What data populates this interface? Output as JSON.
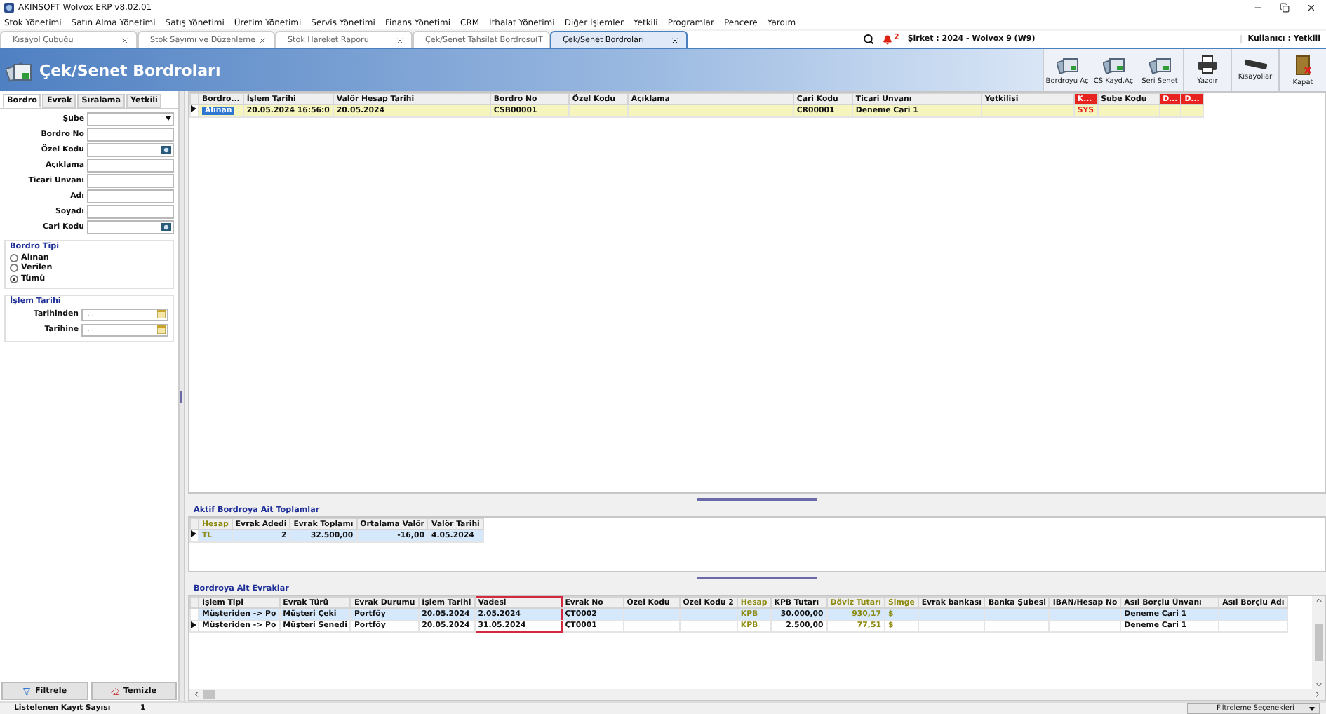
{
  "window": {
    "title": "AKINSOFT Wolvox ERP v8.02.01"
  },
  "menu": [
    "Stok Yönetimi",
    "Satın Alma Yönetimi",
    "Satış Yönetimi",
    "Üretim Yönetimi",
    "Servis Yönetimi",
    "Finans Yönetimi",
    "CRM",
    "İthalat Yönetimi",
    "Diğer İşlemler",
    "Yetkili",
    "Programlar",
    "Pencere",
    "Yardım"
  ],
  "doc_tabs": [
    {
      "label": "Kısayol Çubuğu",
      "selected": false
    },
    {
      "label": "Stok Sayımı ve Düzenleme",
      "selected": false
    },
    {
      "label": "Stok Hareket Raporu",
      "selected": false
    },
    {
      "label": "Çek/Senet Tahsilat Bordrosu(T",
      "selected": false
    },
    {
      "label": "Çek/Senet Bordroları",
      "selected": true
    }
  ],
  "notifications": {
    "count": "2"
  },
  "company": "Şirket : 2024 - Wolvox 9  (W9)",
  "user": "Kullanıcı : Yetkili",
  "page_title": "Çek/Senet Bordroları",
  "toolbar": [
    {
      "label": "Bordroyu Aç",
      "kind": "docs"
    },
    {
      "label": "CS Kayd.Aç",
      "kind": "docs"
    },
    {
      "label": "Seri Senet",
      "kind": "docs"
    },
    {
      "label": "Yazdır",
      "kind": "printer"
    },
    {
      "label": "Kısayollar",
      "kind": "keyboard"
    },
    {
      "label": "Kapat",
      "kind": "door"
    }
  ],
  "filter_tabs": [
    {
      "label": "Bordro",
      "selected": true
    },
    {
      "label": "Evrak",
      "selected": false
    },
    {
      "label": "Sıralama",
      "selected": false
    },
    {
      "label": "Yetkili",
      "selected": false
    }
  ],
  "filter_fields": [
    {
      "label": "Şube",
      "kind": "dropdown"
    },
    {
      "label": "Bordro No",
      "kind": "text"
    },
    {
      "label": "Özel Kodu",
      "kind": "lookup"
    },
    {
      "label": "Açıklama",
      "kind": "text"
    },
    {
      "label": "Ticari Unvanı",
      "kind": "text"
    },
    {
      "label": "Adı",
      "kind": "text"
    },
    {
      "label": "Soyadı",
      "kind": "text"
    },
    {
      "label": "Cari Kodu",
      "kind": "lookup"
    }
  ],
  "bordro_tipi": {
    "title": "Bordro Tipi",
    "options": [
      {
        "label": "Alınan",
        "selected": false
      },
      {
        "label": "Verilen",
        "selected": false
      },
      {
        "label": "Tümü",
        "selected": true
      }
    ]
  },
  "islem_tarihi": {
    "title": "İşlem Tarihi",
    "fields": [
      {
        "label": "Tarihinden",
        "value": ". ."
      },
      {
        "label": "Tarihine",
        "value": ". ."
      }
    ]
  },
  "filter_buttons": [
    "Filtrele",
    "Temizle"
  ],
  "record_count": {
    "label": "Listelenen Kayıt Sayısı",
    "value": "1"
  },
  "filter_options": "Filtreleme Seçenekleri",
  "bordro_grid": {
    "columns": [
      {
        "label": "Bordro...",
        "kind": "text"
      },
      {
        "label": "İşlem Tarihi",
        "kind": "text"
      },
      {
        "label": "Valör Hesap Tarihi",
        "kind": "text"
      },
      {
        "label": "Bordro No",
        "kind": "text"
      },
      {
        "label": "Özel Kodu",
        "kind": "text"
      },
      {
        "label": "Açıklama",
        "kind": "text"
      },
      {
        "label": "Cari Kodu",
        "kind": "text"
      },
      {
        "label": "Ticari Unvanı",
        "kind": "text"
      },
      {
        "label": "Yetkilisi",
        "kind": "text"
      },
      {
        "label": "K...",
        "kind": "alert"
      },
      {
        "label": "Şube Kodu",
        "kind": "text"
      },
      {
        "label": "D...",
        "kind": "alert"
      },
      {
        "label": "D...",
        "kind": "alert"
      }
    ],
    "rows": [
      {
        "current": true,
        "selected": true,
        "cells": [
          "Alınan",
          "20.05.2024 16:56:0",
          "20.05.2024",
          "CSB00001",
          "",
          "",
          "CR00001",
          "Deneme Cari 1",
          "",
          "SYS",
          "",
          "",
          ""
        ]
      }
    ]
  },
  "totals": {
    "title": "Aktif Bordroya Ait Toplamlar",
    "columns": [
      {
        "label": "Hesap",
        "kind": "currency"
      },
      {
        "label": "Evrak Adedi",
        "kind": "number"
      },
      {
        "label": "Evrak Toplamı",
        "kind": "number"
      },
      {
        "label": "Ortalama Valör",
        "kind": "number"
      },
      {
        "label": "Valör Tarihi",
        "kind": "text"
      }
    ],
    "rows": [
      {
        "current": true,
        "selected": true,
        "cells": [
          "TL",
          "2",
          "32.500,00",
          "-16,00",
          "4.05.2024"
        ]
      }
    ]
  },
  "documents": {
    "title": "Bordroya Ait Evraklar",
    "columns": [
      {
        "label": "İşlem Tipi",
        "kind": "text",
        "highlighted": false
      },
      {
        "label": "Evrak Türü",
        "kind": "text",
        "highlighted": false
      },
      {
        "label": "Evrak Durumu",
        "kind": "text",
        "highlighted": false
      },
      {
        "label": "İşlem Tarihi",
        "kind": "text",
        "highlighted": false
      },
      {
        "label": "Vadesi",
        "kind": "text",
        "highlighted": true
      },
      {
        "label": "Evrak No",
        "kind": "text",
        "highlighted": false
      },
      {
        "label": "Özel Kodu",
        "kind": "text",
        "highlighted": false
      },
      {
        "label": "Özel Kodu 2",
        "kind": "text",
        "highlighted": false
      },
      {
        "label": "Hesap",
        "kind": "currency",
        "highlighted": false
      },
      {
        "label": "KPB Tutarı",
        "kind": "number",
        "highlighted": false
      },
      {
        "label": "Döviz Tutarı",
        "kind": "currency-number",
        "highlighted": false
      },
      {
        "label": "Simge",
        "kind": "currency",
        "highlighted": false
      },
      {
        "label": "Evrak bankası",
        "kind": "text",
        "highlighted": false
      },
      {
        "label": "Banka Şubesi",
        "kind": "text",
        "highlighted": false
      },
      {
        "label": "IBAN/Hesap No",
        "kind": "text",
        "highlighted": false
      },
      {
        "label": "Asıl Borçlu Ünvanı",
        "kind": "text",
        "highlighted": false
      },
      {
        "label": "Asıl Borçlu Adı",
        "kind": "text",
        "highlighted": false
      }
    ],
    "rows": [
      {
        "current": false,
        "selected": true,
        "cells": [
          "Müşteriden -> Po",
          "Müşteri Çeki",
          "Portföy",
          "20.05.2024",
          "2.05.2024",
          "ÇT0002",
          "",
          "",
          "KPB",
          "30.000,00",
          "930,17",
          "$",
          "",
          "",
          "",
          "Deneme Cari 1",
          ""
        ]
      },
      {
        "current": true,
        "selected": false,
        "cells": [
          "Müşteriden -> Po",
          "Müşteri Senedi",
          "Portföy",
          "20.05.2024",
          "31.05.2024",
          "ÇT0001",
          "",
          "",
          "KPB",
          "2.500,00",
          "77,51",
          "$",
          "",
          "",
          "",
          "Deneme Cari 1",
          ""
        ]
      }
    ]
  }
}
